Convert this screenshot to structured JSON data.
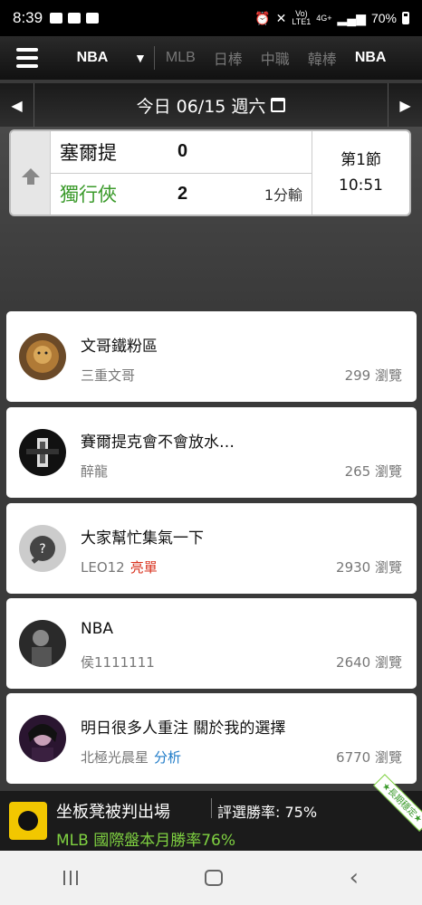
{
  "status_bar": {
    "time": "8:39",
    "network_top": "Vo)",
    "network_bottom": "LTE1",
    "generation": "4G+",
    "battery": "70%"
  },
  "nav": {
    "current_league": "NBA",
    "leagues": [
      "MLB",
      "日棒",
      "中職",
      "韓棒",
      "NBA"
    ]
  },
  "date_bar": {
    "date_text": "今日 06/15 週六"
  },
  "game": {
    "team1_name": "塞爾提",
    "team1_score": "0",
    "team2_name": "獨行俠",
    "team2_score": "2",
    "result": "1分輸",
    "period": "第1節",
    "clock": "10:51",
    "team2_color": "#3a9a2a"
  },
  "posts": [
    {
      "title": "文哥鐵粉區",
      "author": "三重文哥",
      "tag": "",
      "views": "299 瀏覽"
    },
    {
      "title": "賽爾提克會不會放水…",
      "author": "醉龍",
      "tag": "",
      "views": "265 瀏覽"
    },
    {
      "title": "大家幫忙集氣一下",
      "author": "LEO12",
      "tag": "亮單",
      "views": "2930 瀏覽"
    },
    {
      "title": "NBA",
      "author": "侯1111111",
      "tag": "",
      "views": "2640 瀏覽"
    },
    {
      "title": "明日很多人重注 關於我的選擇",
      "author": "北極光晨星",
      "tag": "分析",
      "views": "6770 瀏覽"
    }
  ],
  "banner": {
    "title": "坐板凳被判出場",
    "rate": "評選勝率: 75%",
    "promo": "MLB 國際盤本月勝率76%",
    "ribbon": "★長期穩定★"
  }
}
